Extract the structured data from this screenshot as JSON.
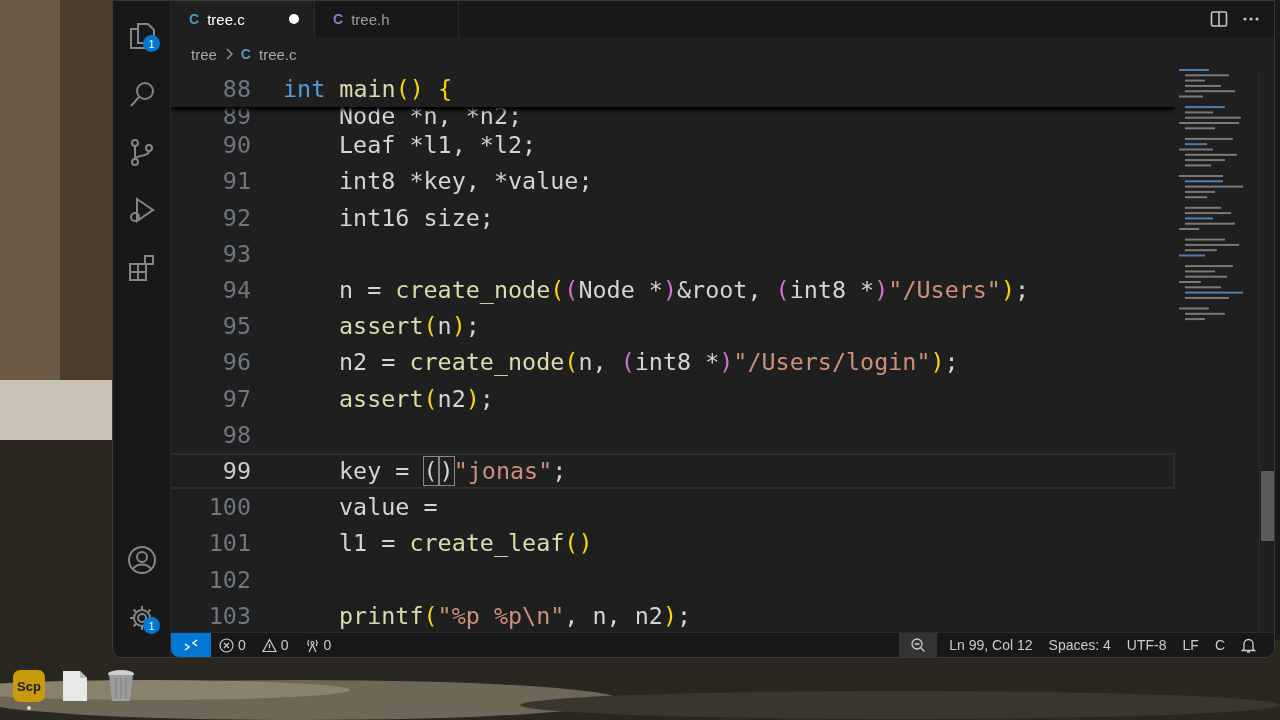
{
  "activity_bar": {
    "top": [
      {
        "kind": "files",
        "badge": "1"
      },
      {
        "kind": "search"
      },
      {
        "kind": "source_control"
      },
      {
        "kind": "run_debug"
      },
      {
        "kind": "extensions"
      }
    ],
    "bottom": [
      {
        "kind": "account"
      },
      {
        "kind": "settings",
        "badge": "1"
      }
    ]
  },
  "tabs": [
    {
      "icon": "C",
      "color": "#519aba",
      "label": "tree.c",
      "modified": true,
      "selected": true
    },
    {
      "icon": "C",
      "color": "#a074c4",
      "label": "tree.h",
      "modified": false,
      "selected": false
    }
  ],
  "breadcrumb": {
    "folder": "tree",
    "file_icon": "C",
    "file": "tree.c"
  },
  "editor": {
    "number": "88",
    "tokens": [
      {
        "kind": "keyword",
        "text": "int "
      },
      {
        "kind": "function",
        "text": "main"
      },
      {
        "kind": "b1",
        "text": "() {"
      }
    ],
    "children": [
      {
        "number": "89",
        "under_sticky": true,
        "current": false,
        "tokens": [
          {
            "kind": "plain",
            "text": "Node *n, *n2;"
          }
        ]
      },
      {
        "number": "90",
        "current": false,
        "tokens": [
          {
            "kind": "plain",
            "text": "Leaf *l1, *l2;"
          }
        ]
      },
      {
        "number": "91",
        "current": false,
        "tokens": [
          {
            "kind": "plain",
            "text": "int8 *key, *value;"
          }
        ]
      },
      {
        "number": "92",
        "current": false,
        "tokens": [
          {
            "kind": "plain",
            "text": "int16 size;"
          }
        ]
      },
      {
        "number": "93",
        "current": false
      },
      {
        "number": "94",
        "current": false,
        "tokens": [
          {
            "kind": "plain",
            "text": "n = "
          },
          {
            "kind": "function",
            "text": "create_node"
          },
          {
            "kind": "b1",
            "text": "("
          },
          {
            "kind": "b2",
            "text": "("
          },
          {
            "kind": "plain",
            "text": "Node *"
          },
          {
            "kind": "b2",
            "text": ")"
          },
          {
            "kind": "plain",
            "text": "&root, "
          },
          {
            "kind": "b2",
            "text": "("
          },
          {
            "kind": "plain",
            "text": "int8 *"
          },
          {
            "kind": "b2",
            "text": ")"
          },
          {
            "kind": "string",
            "text": "\"/Users\""
          },
          {
            "kind": "b1",
            "text": ")"
          },
          {
            "kind": "plain",
            "text": ";"
          }
        ]
      },
      {
        "number": "95",
        "current": false,
        "tokens": [
          {
            "kind": "function",
            "text": "assert"
          },
          {
            "kind": "b1",
            "text": "("
          },
          {
            "kind": "plain",
            "text": "n"
          },
          {
            "kind": "b1",
            "text": ")"
          },
          {
            "kind": "plain",
            "text": ";"
          }
        ]
      },
      {
        "number": "96",
        "current": false,
        "tokens": [
          {
            "kind": "plain",
            "text": "n2 = "
          },
          {
            "kind": "function",
            "text": "create_node"
          },
          {
            "kind": "b1",
            "text": "("
          },
          {
            "kind": "plain",
            "text": "n, "
          },
          {
            "kind": "b2",
            "text": "("
          },
          {
            "kind": "plain",
            "text": "int8 *"
          },
          {
            "kind": "b2",
            "text": ")"
          },
          {
            "kind": "string",
            "text": "\"/Users/login\""
          },
          {
            "kind": "b1",
            "text": ")"
          },
          {
            "kind": "plain",
            "text": ";"
          }
        ]
      },
      {
        "number": "97",
        "current": false,
        "tokens": [
          {
            "kind": "function",
            "text": "assert"
          },
          {
            "kind": "b1",
            "text": "("
          },
          {
            "kind": "plain",
            "text": "n2"
          },
          {
            "kind": "b1",
            "text": ")"
          },
          {
            "kind": "plain",
            "text": ";"
          }
        ]
      },
      {
        "number": "98",
        "current": false
      },
      {
        "number": "99",
        "current": true,
        "tokens": [
          {
            "kind": "plain",
            "text": "key = "
          },
          {
            "kind": "match",
            "text": "("
          },
          {
            "kind": "cursor"
          },
          {
            "kind": "match",
            "text": ")"
          },
          {
            "kind": "string",
            "text": "\"jonas\""
          },
          {
            "kind": "plain",
            "text": ";"
          }
        ]
      },
      {
        "number": "100",
        "current": false,
        "tokens": [
          {
            "kind": "plain",
            "text": "value ="
          }
        ]
      },
      {
        "number": "101",
        "current": false,
        "tokens": [
          {
            "kind": "plain",
            "text": "l1 = "
          },
          {
            "kind": "function",
            "text": "create_leaf"
          },
          {
            "kind": "b1",
            "text": "()"
          }
        ]
      },
      {
        "number": "102",
        "current": false
      },
      {
        "number": "103",
        "current": false,
        "tokens": [
          {
            "kind": "function",
            "text": "printf"
          },
          {
            "kind": "b1",
            "text": "("
          },
          {
            "kind": "string",
            "text": "\"%p %p\\n\""
          },
          {
            "kind": "plain",
            "text": ", n, n2"
          },
          {
            "kind": "b1",
            "text": ")"
          },
          {
            "kind": "plain",
            "text": ";"
          }
        ]
      }
    ]
  },
  "status_bar": {
    "left": [
      {
        "kind": "errors",
        "text": "0"
      },
      {
        "kind": "warnings",
        "text": "0"
      },
      {
        "kind": "ports",
        "text": "0"
      }
    ],
    "right": [
      {
        "kind": "zoom"
      },
      {
        "kind": "text",
        "text": "Ln 99, Col 12"
      },
      {
        "kind": "text",
        "text": "Spaces: 4"
      },
      {
        "kind": "text",
        "text": "UTF-8"
      },
      {
        "kind": "text",
        "text": "LF"
      },
      {
        "kind": "text",
        "text": "C"
      },
      {
        "kind": "bell"
      }
    ]
  },
  "dock": [
    {
      "kind": "app",
      "label": "Scp",
      "running": true
    },
    {
      "kind": "document",
      "running": false
    },
    {
      "kind": "trash",
      "running": false
    }
  ]
}
